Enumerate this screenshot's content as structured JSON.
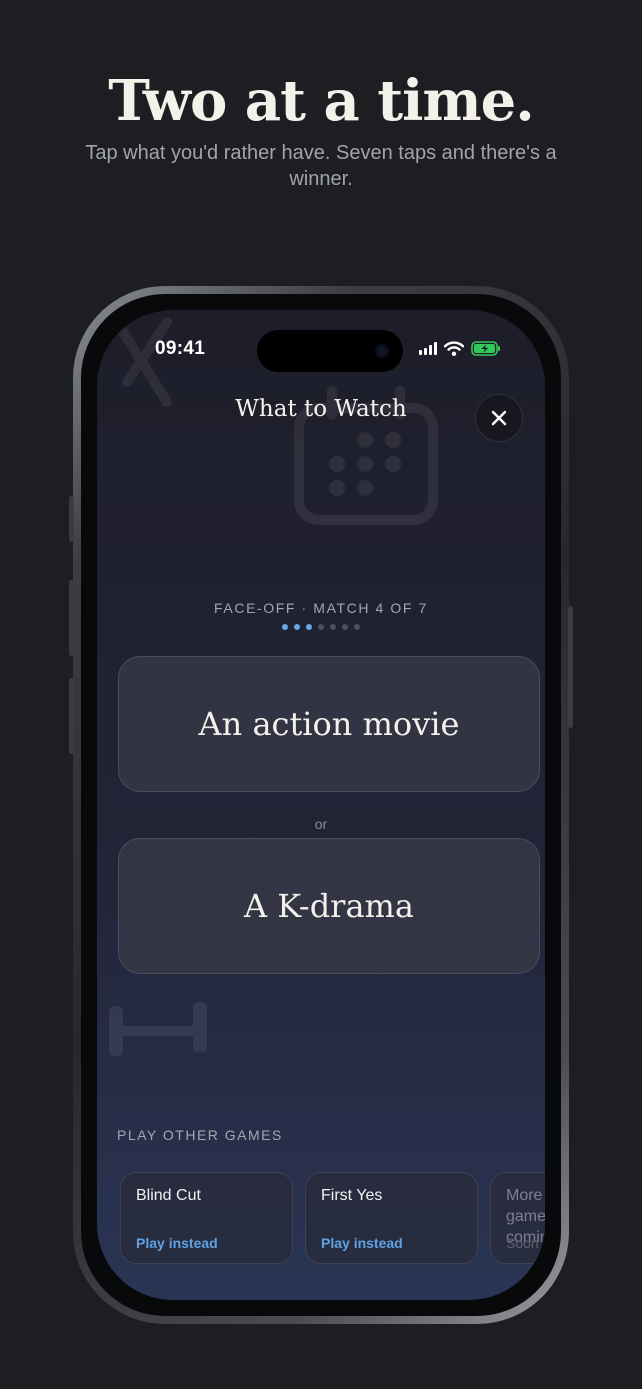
{
  "hero": {
    "title": "Two at a time.",
    "subtitle": "Tap what you'd rather have. Seven taps and there's a winner."
  },
  "status_bar": {
    "time": "09:41",
    "icons": [
      "cellular-signal-icon",
      "wifi-icon",
      "battery-charging-icon"
    ],
    "battery_color": "#34c759"
  },
  "app": {
    "title": "What to Watch",
    "close_icon": "close-icon",
    "match_label": "FACE-OFF · MATCH 4 OF 7",
    "progress": {
      "total": 7,
      "highlighted": 3
    },
    "choices": [
      {
        "label": "An action movie"
      },
      {
        "label": "A K-drama"
      }
    ],
    "or_label": "or",
    "other_games_header": "PLAY OTHER GAMES",
    "other_games": [
      {
        "name": "Blind Cut",
        "action": "Play instead",
        "enabled": true
      },
      {
        "name": "First Yes",
        "action": "Play instead",
        "enabled": true
      },
      {
        "name": "More games coming",
        "action": "Soon",
        "enabled": false
      }
    ]
  },
  "colors": {
    "page_background": "#1d1e22",
    "accent": "#5ea2e6",
    "active_dot": "#6aa7ea"
  }
}
